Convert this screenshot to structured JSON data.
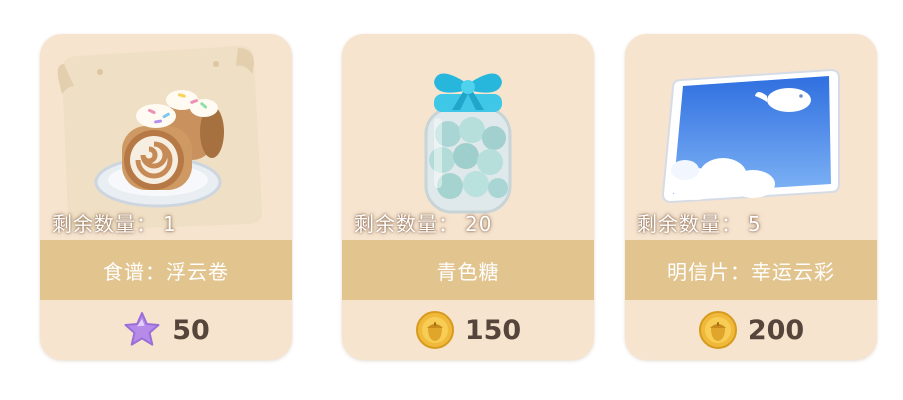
{
  "items": [
    {
      "stock_label": "剩余数量：",
      "stock": "1",
      "name": "食谱：浮云卷",
      "price": "50",
      "currency_icon": "purple-star-icon",
      "image": "swiss-roll-recipe"
    },
    {
      "stock_label": "剩余数量：",
      "stock": "20",
      "name": "青色糖",
      "price": "150",
      "currency_icon": "gold-acorn-coin-icon",
      "image": "candy-jar-with-blue-bow"
    },
    {
      "stock_label": "剩余数量：",
      "stock": "5",
      "name": "明信片：幸运云彩",
      "price": "200",
      "currency_icon": "gold-acorn-coin-icon",
      "image": "sky-postcard-with-whale-cloud"
    }
  ],
  "colors": {
    "card_bg": "#f6e4cf",
    "name_band": "#e2c48f",
    "price_text": "#55453a",
    "coin_gold": "#f0b93a",
    "star_purple": "#b68ae8"
  }
}
